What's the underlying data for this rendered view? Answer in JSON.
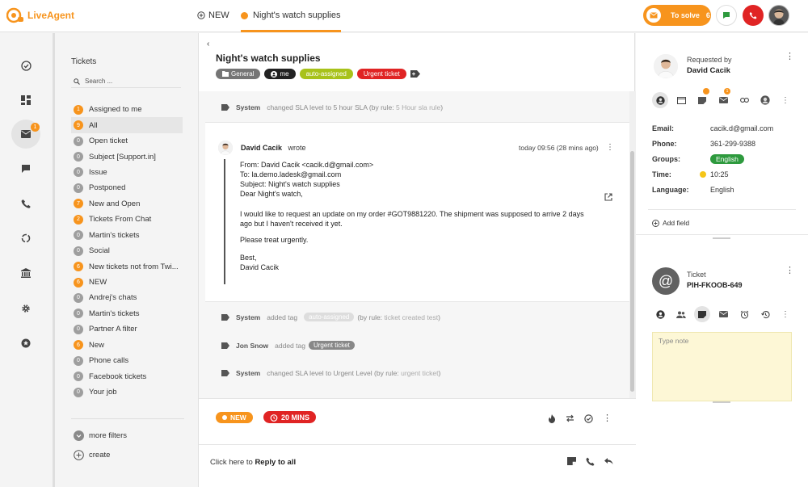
{
  "app": {
    "brand": "LiveAgent"
  },
  "topbar": {
    "new_tab_label": "NEW",
    "active_tab_label": "Night's watch supplies",
    "to_solve_label": "To solve",
    "to_solve_count": "6"
  },
  "rail": {
    "items": [
      "dashboard",
      "reports",
      "tickets",
      "chats",
      "calls",
      "contacts",
      "knowledgebase",
      "settings",
      "plugins"
    ],
    "tickets_badge": "1"
  },
  "folders": {
    "title": "Tickets",
    "search_placeholder": "Search ...",
    "items": [
      {
        "count": "1",
        "label": "Assigned to me",
        "tone": "orange"
      },
      {
        "count": "9",
        "label": "All",
        "tone": "orange"
      },
      {
        "count": "0",
        "label": "Open ticket",
        "tone": "grey"
      },
      {
        "count": "0",
        "label": "Subject [Support.in]",
        "tone": "grey"
      },
      {
        "count": "0",
        "label": "Issue",
        "tone": "grey"
      },
      {
        "count": "0",
        "label": "Postponed",
        "tone": "grey"
      },
      {
        "count": "7",
        "label": "New and Open",
        "tone": "orange"
      },
      {
        "count": "2",
        "label": "Tickets From Chat",
        "tone": "orange"
      },
      {
        "count": "0",
        "label": "Martin's tickets",
        "tone": "grey"
      },
      {
        "count": "0",
        "label": "Social",
        "tone": "grey"
      },
      {
        "count": "6",
        "label": "New tickets not from Twi...",
        "tone": "orange"
      },
      {
        "count": "6",
        "label": "NEW",
        "tone": "orange"
      },
      {
        "count": "0",
        "label": "Andrej's chats",
        "tone": "grey"
      },
      {
        "count": "0",
        "label": "Martin's tickets",
        "tone": "grey"
      },
      {
        "count": "0",
        "label": "Partner A filter",
        "tone": "grey"
      },
      {
        "count": "6",
        "label": "New",
        "tone": "orange"
      },
      {
        "count": "0",
        "label": "Phone calls",
        "tone": "grey"
      },
      {
        "count": "0",
        "label": "Facebook tickets",
        "tone": "grey"
      },
      {
        "count": "0",
        "label": "Your job",
        "tone": "grey"
      }
    ],
    "more_filters": "more filters",
    "create": "create"
  },
  "ticket": {
    "subject": "Night's watch supplies",
    "tags": [
      {
        "label": "General",
        "color": "#757575"
      },
      {
        "label": "me",
        "color": "#222222"
      },
      {
        "label": "auto-assigned",
        "color": "#a8c21a"
      },
      {
        "label": "Urgent ticket",
        "color": "#e02424"
      }
    ],
    "events": {
      "sla1": {
        "who": "System",
        "text": "changed SLA level to 5 hour SLA",
        "rule": "(by rule: ",
        "rule_name": "5 Hour sla rule",
        "close": ")"
      },
      "tag1": {
        "who": "System",
        "text": "added tag",
        "tag": "auto-assigned",
        "rule": "(by rule:",
        "rule_name": "ticket created test",
        "close": ")"
      },
      "tag2": {
        "who": "Jon Snow",
        "text": "added tag",
        "tag": "Urgent ticket"
      },
      "sla2": {
        "who": "System",
        "text": "changed SLA level to Urgent Level",
        "rule": "(by rule:",
        "rule_name": "urgent ticket",
        "close": ")"
      }
    },
    "message": {
      "author": "David Cacik",
      "wrote": "wrote",
      "time": "today 09:56 (28 mins ago)",
      "from": "From: David Cacik <cacik.d@gmail.com>",
      "to": "To: la.demo.ladesk@gmail.com",
      "subject_line": "Subject: Night's watch supplies",
      "greeting": "Dear Night's watch,",
      "body": "I would like to request an update on my order #GOT9881220. The shipment was supposed to arrive 2 days ago but I haven't received it yet.",
      "ask": "Please treat urgently.",
      "signoff": "Best,",
      "signature": "David Cacik"
    },
    "status": "NEW",
    "sla": "20 MINS",
    "reply_prefix": "Click here to ",
    "reply_action": "Reply to all"
  },
  "customer": {
    "requested_by_label": "Requested by",
    "name": "David Cacik",
    "fields": [
      {
        "key": "Email:",
        "value": "cacik.d@gmail.com",
        "kind": "text"
      },
      {
        "key": "Phone:",
        "value": "361-299-9388",
        "kind": "text"
      },
      {
        "key": "Groups:",
        "value": "English",
        "kind": "group"
      },
      {
        "key": "Time:",
        "value": "10:25",
        "kind": "time"
      },
      {
        "key": "Language:",
        "value": "English",
        "kind": "text"
      }
    ],
    "add_field": "Add field",
    "ticket_label": "Ticket",
    "ticket_id": "PIH-FKOOB-649",
    "note_placeholder": "Type note"
  }
}
